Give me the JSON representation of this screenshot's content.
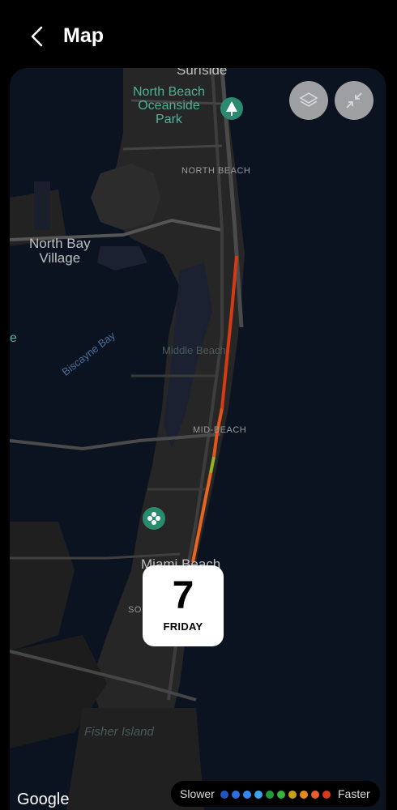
{
  "header": {
    "title": "Map"
  },
  "map": {
    "labels": {
      "surfside": "Surfside",
      "park": "North Beach\nOceanside\nPark",
      "north_beach": "NORTH BEACH",
      "north_bay": "North Bay\nVillage",
      "biscayne": "Biscayne Bay",
      "middle_beach": "Middle Beach",
      "mid_beach": "MID-BEACH",
      "miami_beach": "Miami Beach",
      "so": "SO",
      "fisher": "Fisher Island",
      "edge_e": "e"
    },
    "controls": {
      "layers_icon": "layers-icon",
      "collapse_icon": "collapse-icon"
    },
    "route_colors": [
      "#d63a12",
      "#e0451a",
      "#e3551c",
      "#c9a21b",
      "#95b128",
      "#e8651f",
      "#d43d17"
    ]
  },
  "date_card": {
    "day": "7",
    "weekday": "FRIDAY"
  },
  "attribution": "Google",
  "legend": {
    "slower": "Slower",
    "faster": "Faster",
    "colors": [
      "#1f56c3",
      "#2a6fe0",
      "#3787ee",
      "#3ea3ef",
      "#1f9a3c",
      "#3ab33c",
      "#c9a21b",
      "#e68a1f",
      "#e5602a",
      "#d93a1c"
    ]
  }
}
